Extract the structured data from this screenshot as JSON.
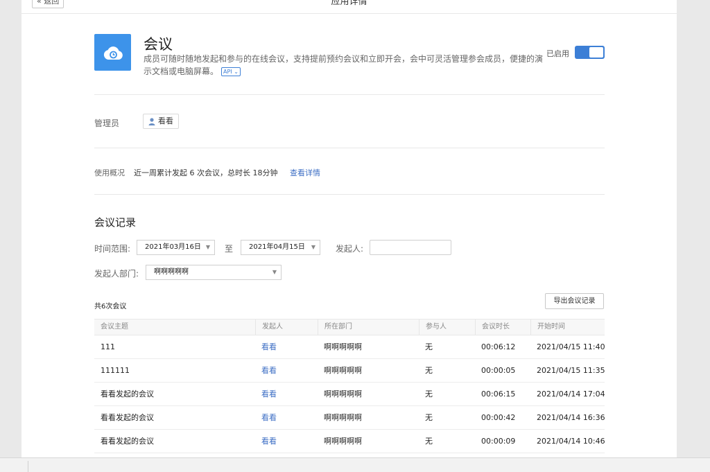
{
  "topbar": {
    "back_label": "« 返回",
    "title": "应用详情"
  },
  "app": {
    "name": "会议",
    "description": "成员可随时随地发起和参与的在线会议，支持提前预约会议和立即开会，会中可灵活管理参会成员，便捷的演示文档或电脑屏幕。",
    "api_badge": "API ⌄",
    "enabled_label": "已启用",
    "enabled": true,
    "icon": "cloud-icon",
    "accent": "#3d93ea"
  },
  "admin": {
    "label": "管理员",
    "user": "看看",
    "user_icon": "user-icon"
  },
  "usage": {
    "label": "使用概况",
    "text": "近一周累计发起 6 次会议，总时长 18分钟",
    "link": "查看详情"
  },
  "records": {
    "title": "会议记录",
    "filters": {
      "time_range_label": "时间范围:",
      "start_date": "2021年03月16日",
      "to_label": "至",
      "end_date": "2021年04月15日",
      "initiator_label": "发起人:",
      "initiator_value": "",
      "dept_label": "发起人部门:",
      "dept_value": "啊啊啊啊啊"
    },
    "count_text": "共6次会议",
    "export_label": "导出会议记录",
    "columns": [
      "会议主题",
      "发起人",
      "所在部门",
      "参与人",
      "会议时长",
      "开始时间"
    ],
    "rows": [
      {
        "topic": "111",
        "initiator": "看看",
        "dept": "啊啊啊啊啊",
        "participants": "无",
        "duration": "00:06:12",
        "start": "2021/04/15 11:40"
      },
      {
        "topic": "111111",
        "initiator": "看看",
        "dept": "啊啊啊啊啊",
        "participants": "无",
        "duration": "00:00:05",
        "start": "2021/04/15 11:35"
      },
      {
        "topic": "看看发起的会议",
        "initiator": "看看",
        "dept": "啊啊啊啊啊",
        "participants": "无",
        "duration": "00:06:15",
        "start": "2021/04/14 17:04"
      },
      {
        "topic": "看看发起的会议",
        "initiator": "看看",
        "dept": "啊啊啊啊啊",
        "participants": "无",
        "duration": "00:00:42",
        "start": "2021/04/14 16:36"
      },
      {
        "topic": "看看发起的会议",
        "initiator": "看看",
        "dept": "啊啊啊啊啊",
        "participants": "无",
        "duration": "00:00:09",
        "start": "2021/04/14 10:46"
      }
    ]
  }
}
